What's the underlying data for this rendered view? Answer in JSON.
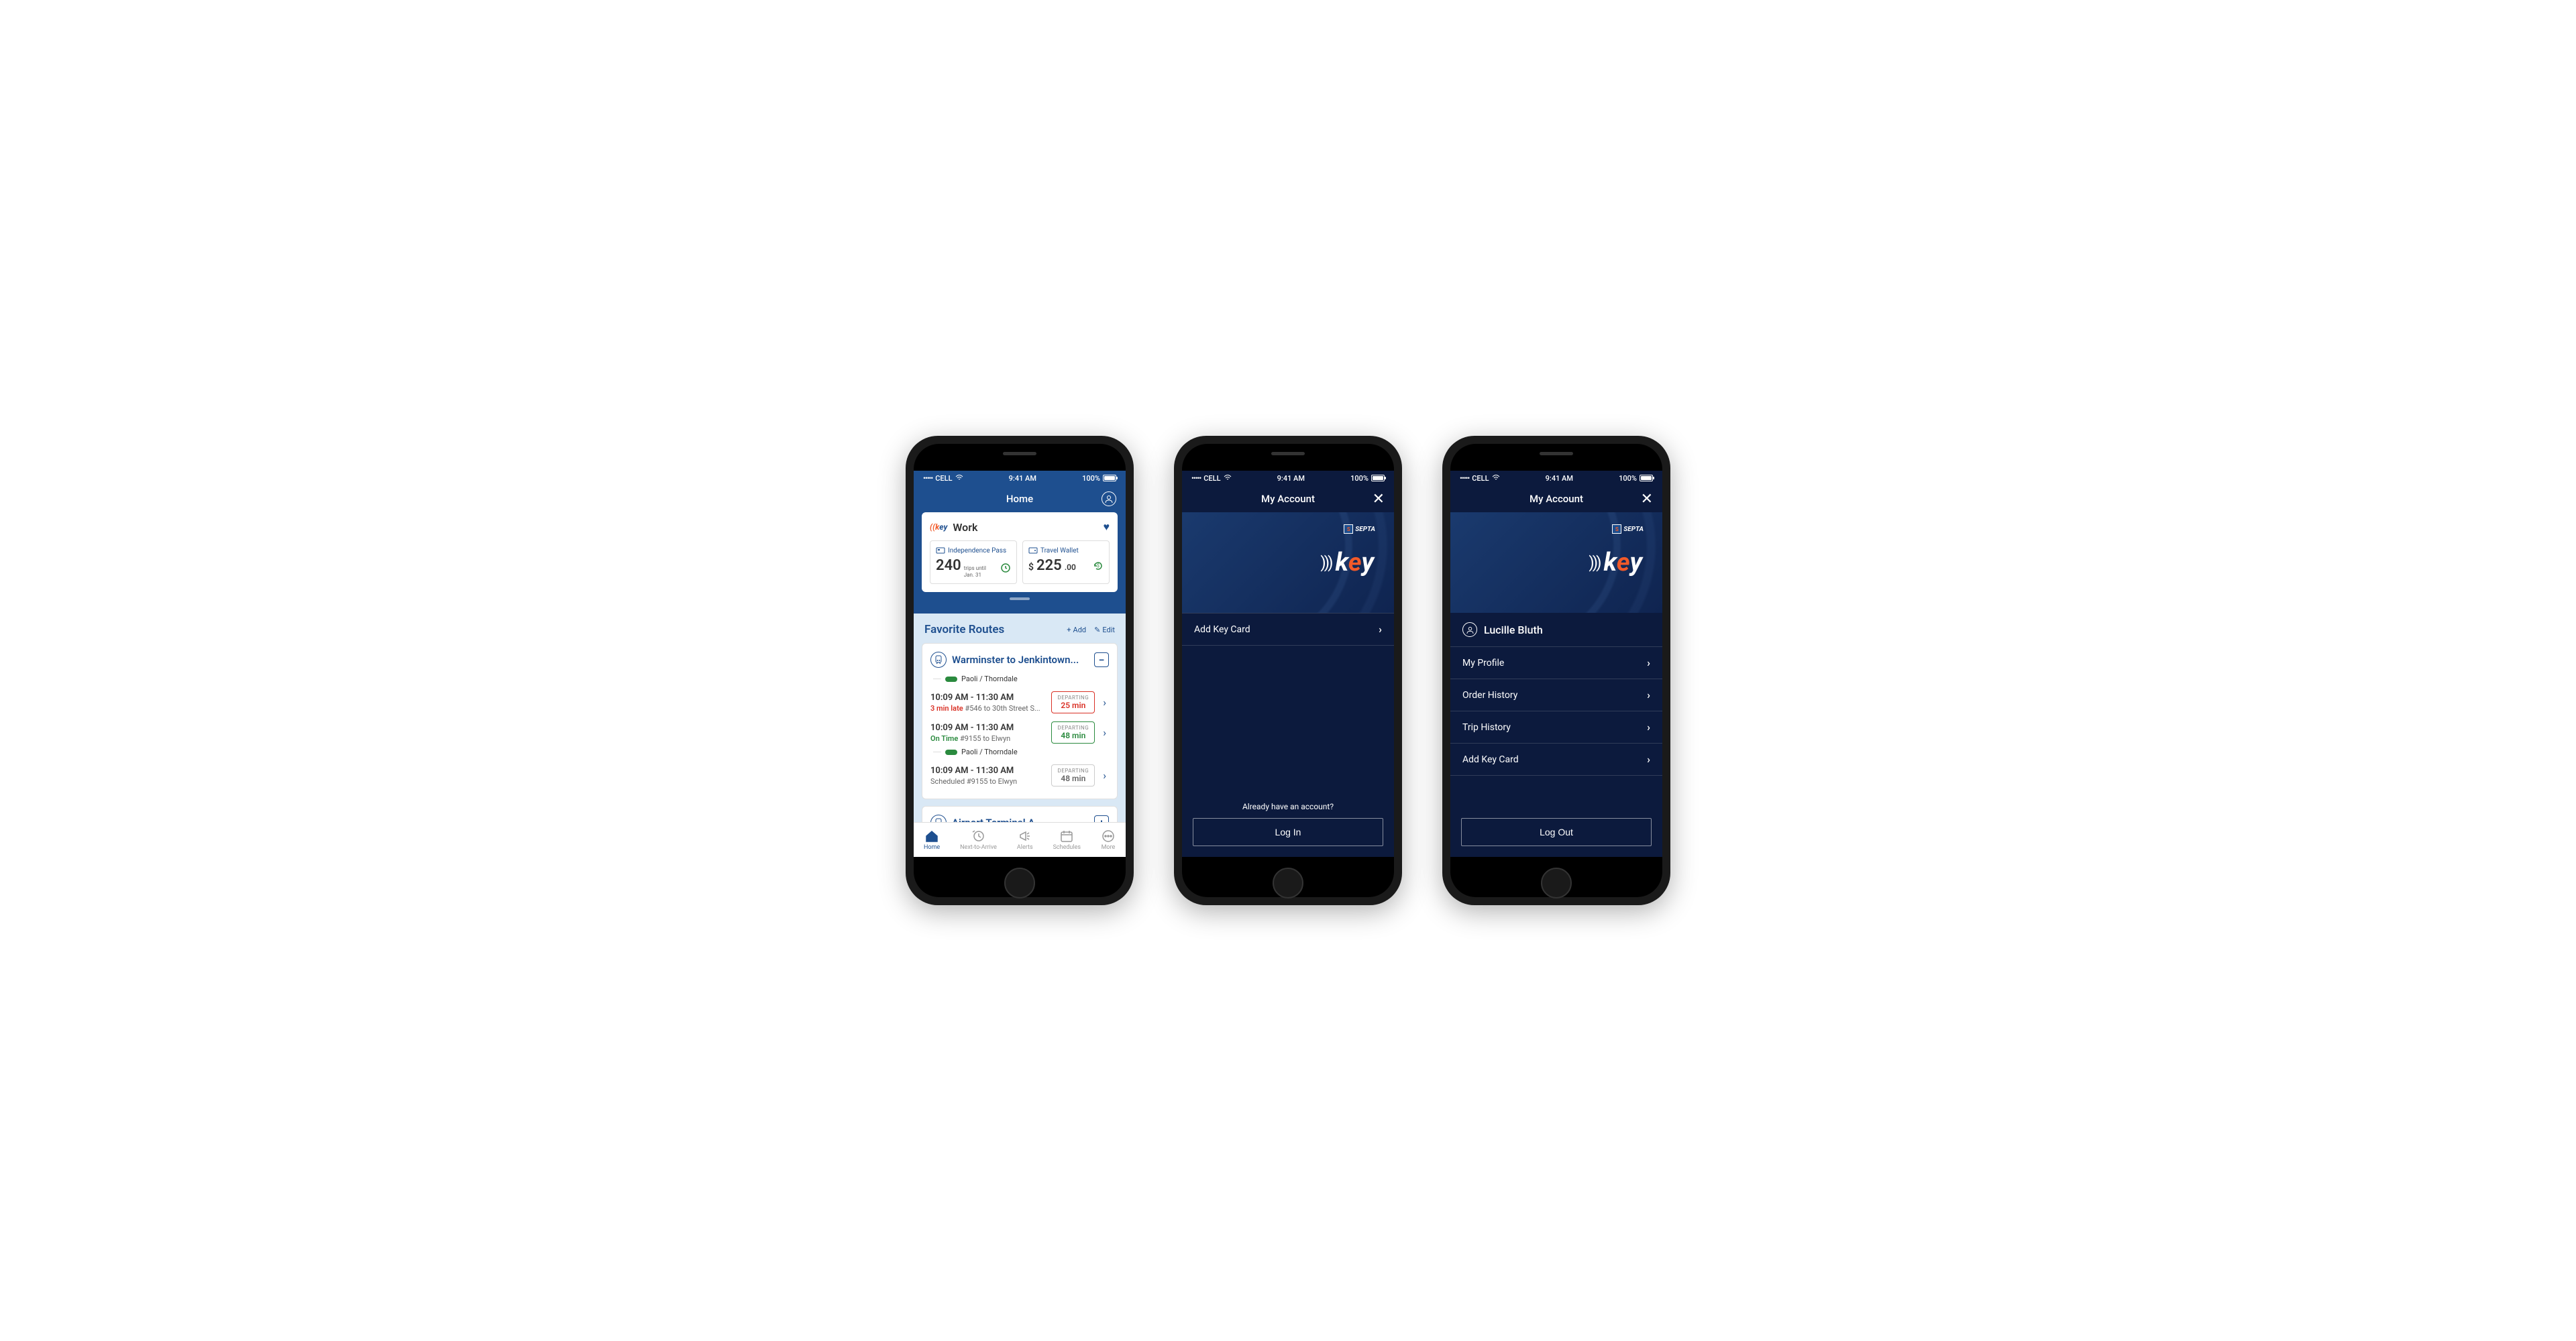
{
  "status_bar": {
    "carrier": "CELL",
    "dots": "•••••",
    "time": "9:41 AM",
    "battery": "100%"
  },
  "screen1": {
    "nav_title": "Home",
    "key_card": {
      "name": "Work",
      "pass": {
        "label": "Independence Pass",
        "value": "240",
        "sub1": "trips until",
        "sub2": "Jan. 31"
      },
      "wallet": {
        "label": "Travel Wallet",
        "dollars": "225",
        "cents": ".00"
      }
    },
    "favorites": {
      "title": "Favorite Routes",
      "add": "Add",
      "edit": "Edit"
    },
    "route1": {
      "title": "Warminster to Jenkintown...",
      "line1": "Paoli / Thorndale",
      "line2": "Paoli / Thorndale",
      "trips": [
        {
          "time": "10:09 AM - 11:30 AM",
          "status_prefix": "3 min late",
          "detail": "#546 to 30th Street S...",
          "depart_label": "DEPARTING",
          "depart_time": "25 min"
        },
        {
          "time": "10:09 AM - 11:30 AM",
          "status_prefix": "On Time",
          "detail": "#9155 to Elwyn",
          "depart_label": "DEPARTING",
          "depart_time": "48 min"
        },
        {
          "time": "10:09 AM - 11:30 AM",
          "status_prefix": "Scheduled",
          "detail": "#9155 to Elwyn",
          "depart_label": "DEPARTING",
          "depart_time": "48 min"
        }
      ]
    },
    "route2": {
      "title": "Airport Terminal A"
    },
    "tabs": {
      "home": "Home",
      "nta": "Next-to-Arrive",
      "alerts": "Alerts",
      "schedules": "Schedules",
      "more": "More"
    }
  },
  "screen2": {
    "nav_title": "My Account",
    "menu": {
      "add_key": "Add Key Card"
    },
    "prompt": "Already have an account?",
    "login": "Log In"
  },
  "screen3": {
    "nav_title": "My Account",
    "user_name": "Lucille Bluth",
    "menu": {
      "profile": "My Profile",
      "orders": "Order History",
      "trips": "Trip History",
      "add_key": "Add Key Card"
    },
    "logout": "Log Out"
  },
  "septa_text": "SEPTA"
}
